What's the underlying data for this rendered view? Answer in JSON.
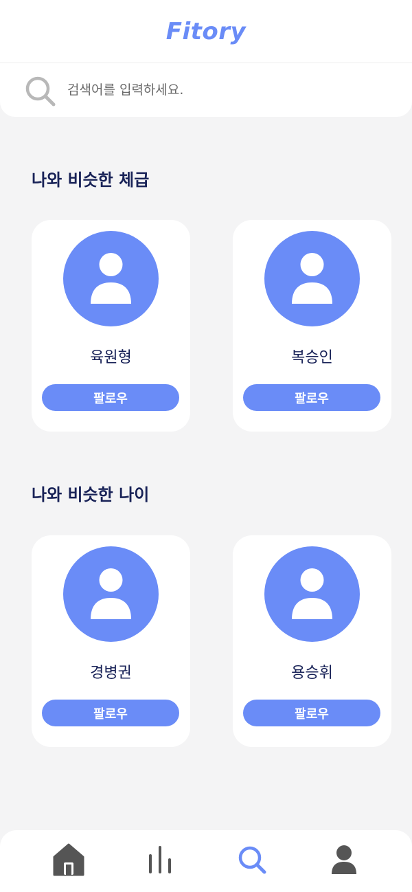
{
  "app": {
    "title": "Fitory"
  },
  "colors": {
    "accent": "#6a8cf7",
    "title": "#182257",
    "nav_icon": "#555555",
    "nav_active": "#6a8cf7",
    "search_icon": "#b8b8b8"
  },
  "search": {
    "placeholder": "검색어를 입력하세요."
  },
  "sections": [
    {
      "title": "나와 비슷한 체급",
      "users": [
        {
          "name": "육원형",
          "follow_label": "팔로우",
          "avatar_icon": "user-avatar-icon"
        },
        {
          "name": "복승인",
          "follow_label": "팔로우",
          "avatar_icon": "user-avatar-icon"
        }
      ]
    },
    {
      "title": "나와 비슷한 나이",
      "users": [
        {
          "name": "경병권",
          "follow_label": "팔로우",
          "avatar_icon": "user-avatar-icon"
        },
        {
          "name": "용승휘",
          "follow_label": "팔로우",
          "avatar_icon": "user-avatar-icon"
        }
      ]
    }
  ],
  "nav": {
    "items": [
      {
        "icon": "home-icon",
        "active": false
      },
      {
        "icon": "stats-icon",
        "active": false
      },
      {
        "icon": "search-icon",
        "active": true
      },
      {
        "icon": "profile-icon",
        "active": false
      }
    ]
  }
}
